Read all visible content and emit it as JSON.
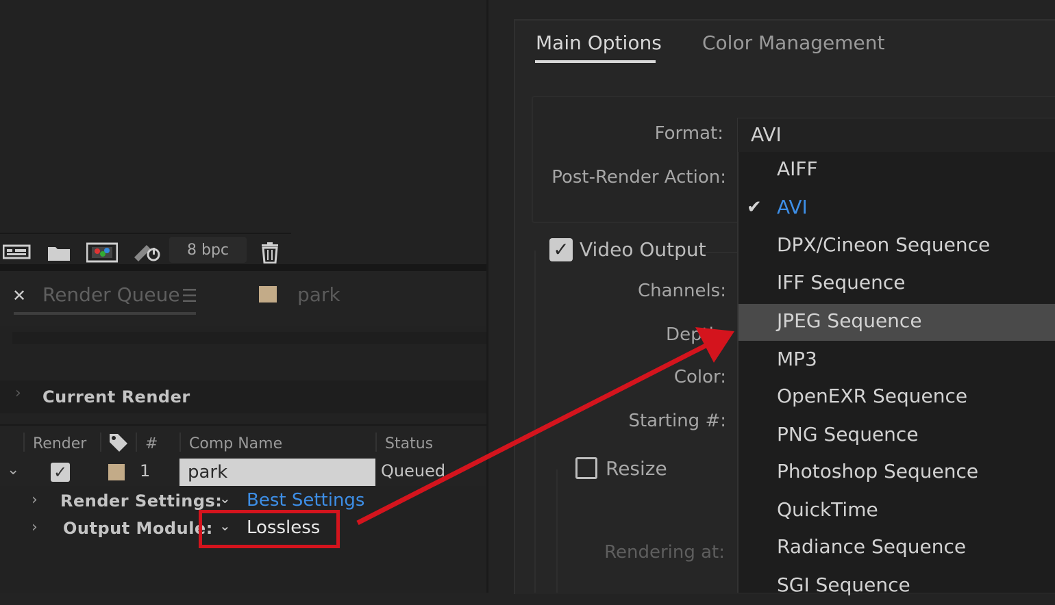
{
  "toolbar": {
    "bpc": "8 bpc"
  },
  "tabs": {
    "render_queue": "Render Queue",
    "comp": "park"
  },
  "current_render": {
    "label": "Current Render"
  },
  "columns": {
    "render": "Render",
    "num": "#",
    "comp_name": "Comp Name",
    "status": "Status"
  },
  "queue_item": {
    "num": "1",
    "comp_name": "park",
    "status": "Queued"
  },
  "render_settings": {
    "label": "Render Settings:",
    "value": "Best Settings"
  },
  "output_module": {
    "label": "Output Module:",
    "value": "Lossless"
  },
  "dialog": {
    "tab_main": "Main Options",
    "tab_color": "Color Management",
    "format_label": "Format:",
    "format_value": "AVI",
    "post_render_label": "Post-Render Action:",
    "video_output_label": "Video Output",
    "channels_label": "Channels:",
    "depth_label": "Depth:",
    "color_label": "Color:",
    "starting_label": "Starting #:",
    "resize_label": "Resize",
    "rendering_at_label": "Rendering at:"
  },
  "format_menu": {
    "items": [
      "AIFF",
      "AVI",
      "DPX/Cineon Sequence",
      "IFF Sequence",
      "JPEG Sequence",
      "MP3",
      "OpenEXR Sequence",
      "PNG Sequence",
      "Photoshop Sequence",
      "QuickTime",
      "Radiance Sequence",
      "SGI Sequence"
    ],
    "selected": "AVI",
    "hovered": "JPEG Sequence"
  },
  "colors": {
    "accent_blue": "#3d8ee6",
    "annotation_red": "#d4141d",
    "label_swatch": "#c3ab88"
  }
}
